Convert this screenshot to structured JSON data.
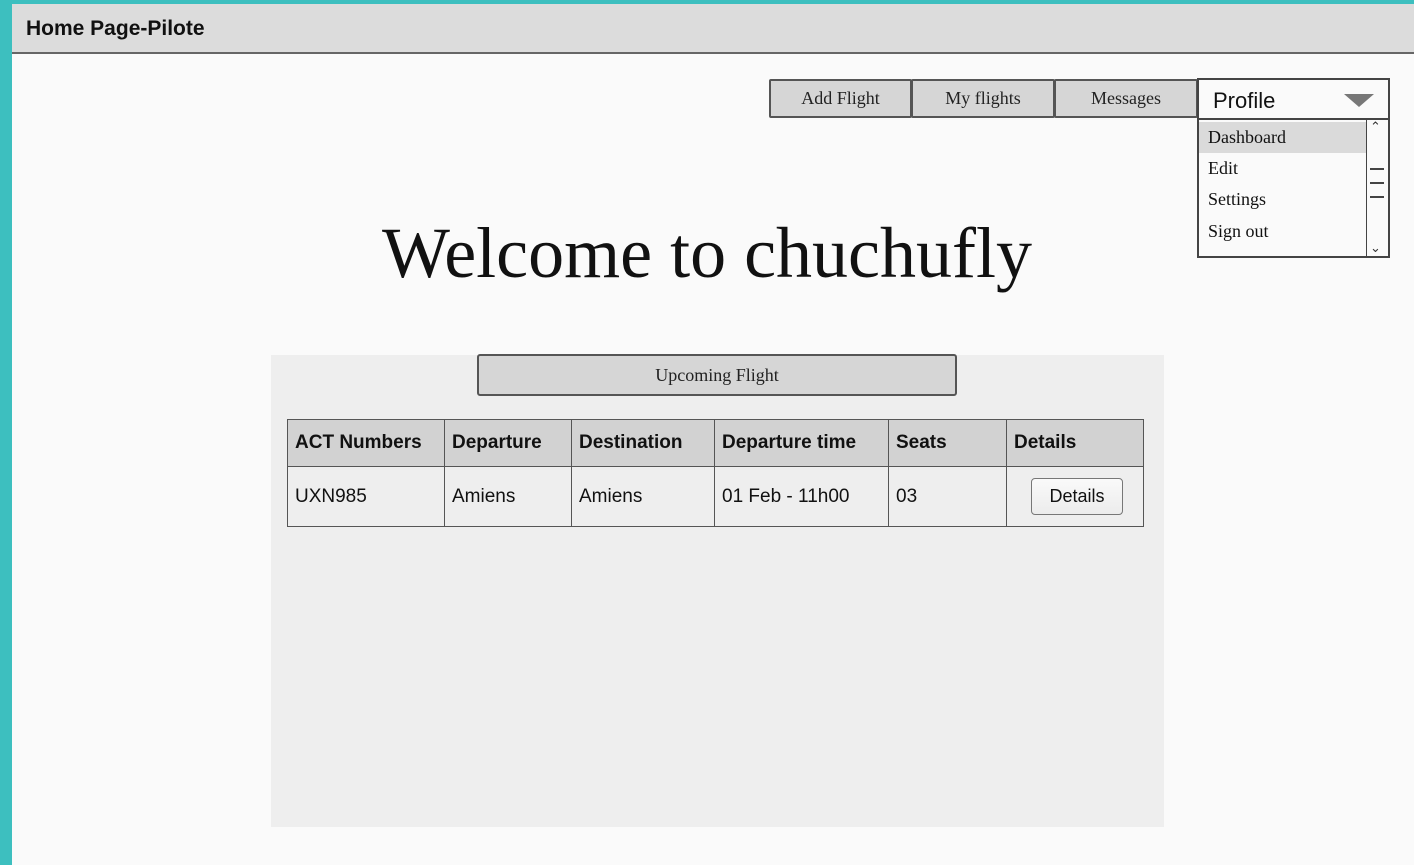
{
  "window": {
    "title": "Home Page-Pilote"
  },
  "nav": {
    "add_flight": "Add Flight",
    "my_flights": "My flights",
    "messages": "Messages",
    "profile": "Profile"
  },
  "profile_menu": {
    "items": [
      "Dashboard",
      "Edit",
      "Settings",
      "Sign out"
    ],
    "selected": "Dashboard"
  },
  "welcome": "Welcome to chuchufly",
  "panel": {
    "title": "Upcoming Flight",
    "columns": [
      "ACT Numbers",
      "Departure",
      "Destination",
      "Departure time",
      "Seats",
      "Details"
    ],
    "rows": [
      {
        "act_number": "UXN985",
        "departure": "Amiens",
        "destination": "Amiens",
        "departure_time": "01 Feb - 11h00",
        "seats": "03",
        "details_label": "Details"
      }
    ]
  },
  "icons": {
    "profile_caret": "chevron-down-icon",
    "scroll_up": "scroll-up-icon",
    "scroll_down": "scroll-down-icon"
  },
  "colors": {
    "background": "#3dbfbf",
    "window": "#fafafa",
    "panel": "#eeeeee",
    "header": "#dcdcdc"
  }
}
